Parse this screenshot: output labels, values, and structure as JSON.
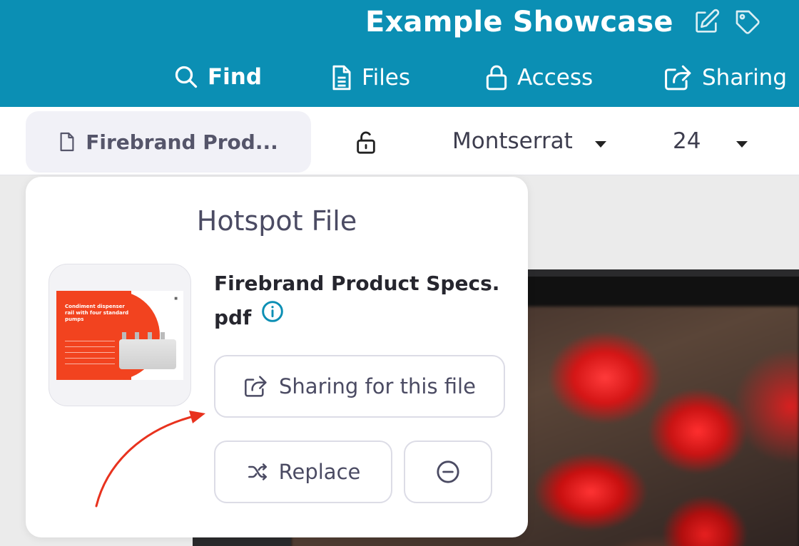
{
  "header": {
    "title": "Example Showcase",
    "title_icons": [
      "edit-icon",
      "tag-icon"
    ],
    "nav": [
      {
        "label": "Find",
        "icon": "search-icon"
      },
      {
        "label": "Files",
        "icon": "file-icon"
      },
      {
        "label": "Access",
        "icon": "lock-icon"
      },
      {
        "label": "Sharing",
        "icon": "share-icon"
      }
    ]
  },
  "toolbar": {
    "file_chip_label": "Firebrand Prod...",
    "lock_icon": "unlock-icon",
    "font_value": "Montserrat",
    "font_size_value": "24"
  },
  "popover": {
    "title": "Hotspot File",
    "file_name": "Firebrand Product Specs. pdf",
    "thumbnail_heading": "Condiment dispenser rail with four standard pumps",
    "share_button_label": "Sharing for this file",
    "replace_button_label": "Replace",
    "remove_button_icon": "minus-circle-icon"
  },
  "colors": {
    "header_bg": "#0b8fb4",
    "annotation_arrow": "#e8321e",
    "info_icon": "#0b8fb4"
  }
}
